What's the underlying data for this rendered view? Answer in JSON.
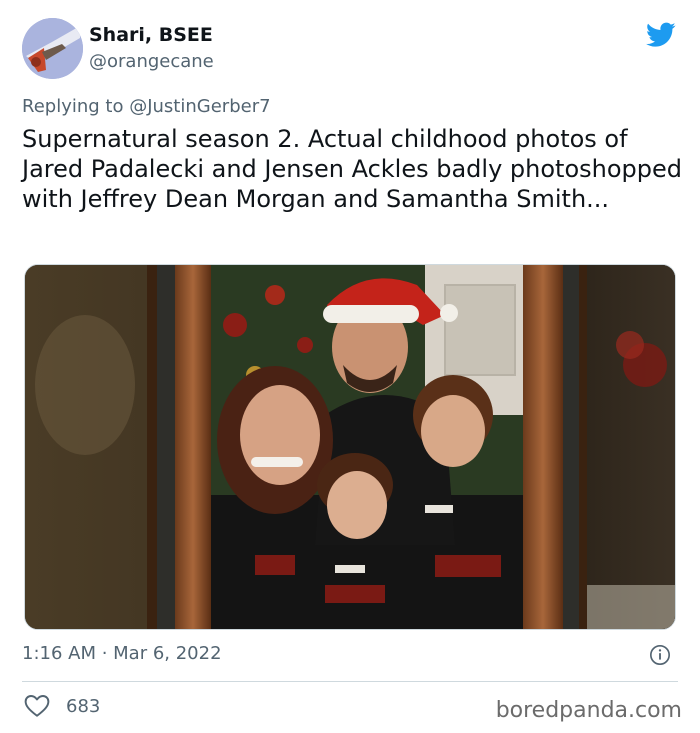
{
  "tweet": {
    "author_name": "Shari, BSEE",
    "author_handle": "@orangecane",
    "replying_prefix": "Replying to ",
    "replying_to": "@JustinGerber7",
    "text": "Supernatural season 2. Actual childhood photos of Jared Padalecki and Jensen Ackles badly photoshopped with Jeffrey Dean Morgan and Samantha Smith...",
    "timestamp": "1:16 AM · Mar 6, 2022",
    "like_count": "683"
  },
  "icons": {
    "brand": "twitter-bird-icon",
    "like": "heart-icon",
    "info": "info-icon"
  },
  "watermark": "boredpanda.com",
  "colors": {
    "twitter_blue": "#1d9bf0",
    "text_primary": "#0f1419",
    "text_secondary": "#536471",
    "divider": "#cfd9de"
  }
}
